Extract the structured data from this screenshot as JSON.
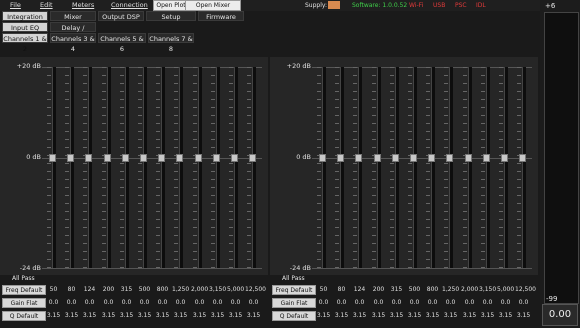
{
  "menu": [
    "File",
    "Edit",
    "Meters",
    "Connection"
  ],
  "top_buttons": [
    "Open Plot",
    "Open Mixer Assist"
  ],
  "status": {
    "supply_label": "Supply:",
    "software": "Software: 1.0.0.52",
    "wifi": "Wi-Fi",
    "usb": "USB",
    "psc": "PSC",
    "idl": "IDL"
  },
  "tabs_row1": [
    "Integration DSP",
    "Mixer",
    "Output DSP",
    "Setup",
    "Firmware"
  ],
  "tabs_row2": [
    "Input EQ",
    "Delay / Phase"
  ],
  "tabs_row3": [
    "Channels 1 & 2",
    "Channels 3 & 4",
    "Channels 5 & 6",
    "Channels 7 & 8"
  ],
  "eq": {
    "db_top": "+20 dB",
    "db_mid": "0 dB",
    "db_bot": "-24 dB",
    "all_pass": "All Pass",
    "freq_label": "Freq Default",
    "gain_label": "Gain Flat",
    "q_label": "Q Default",
    "freqs": [
      "50",
      "80",
      "124",
      "200",
      "315",
      "500",
      "800",
      "1,250",
      "2,000",
      "3,150",
      "5,000",
      "12,500"
    ],
    "gains": [
      "0.0",
      "0.0",
      "0.0",
      "0.0",
      "0.0",
      "0.0",
      "0.0",
      "0.0",
      "0.0",
      "0.0",
      "0.0",
      "0.0"
    ],
    "qs": [
      "3.15",
      "3.15",
      "3.15",
      "3.15",
      "3.15",
      "3.15",
      "3.15",
      "3.15",
      "3.15",
      "3.15",
      "3.15",
      "3.15"
    ]
  },
  "master": {
    "top": "+6",
    "bottom": "-99",
    "value": "0.00"
  },
  "colors": {
    "supply": "#d98a50",
    "software": "#3fd04a",
    "wifi": "#e23a3a",
    "usb": "#e23a3a",
    "psc": "#e23a3a",
    "idl": "#e23a3a"
  }
}
